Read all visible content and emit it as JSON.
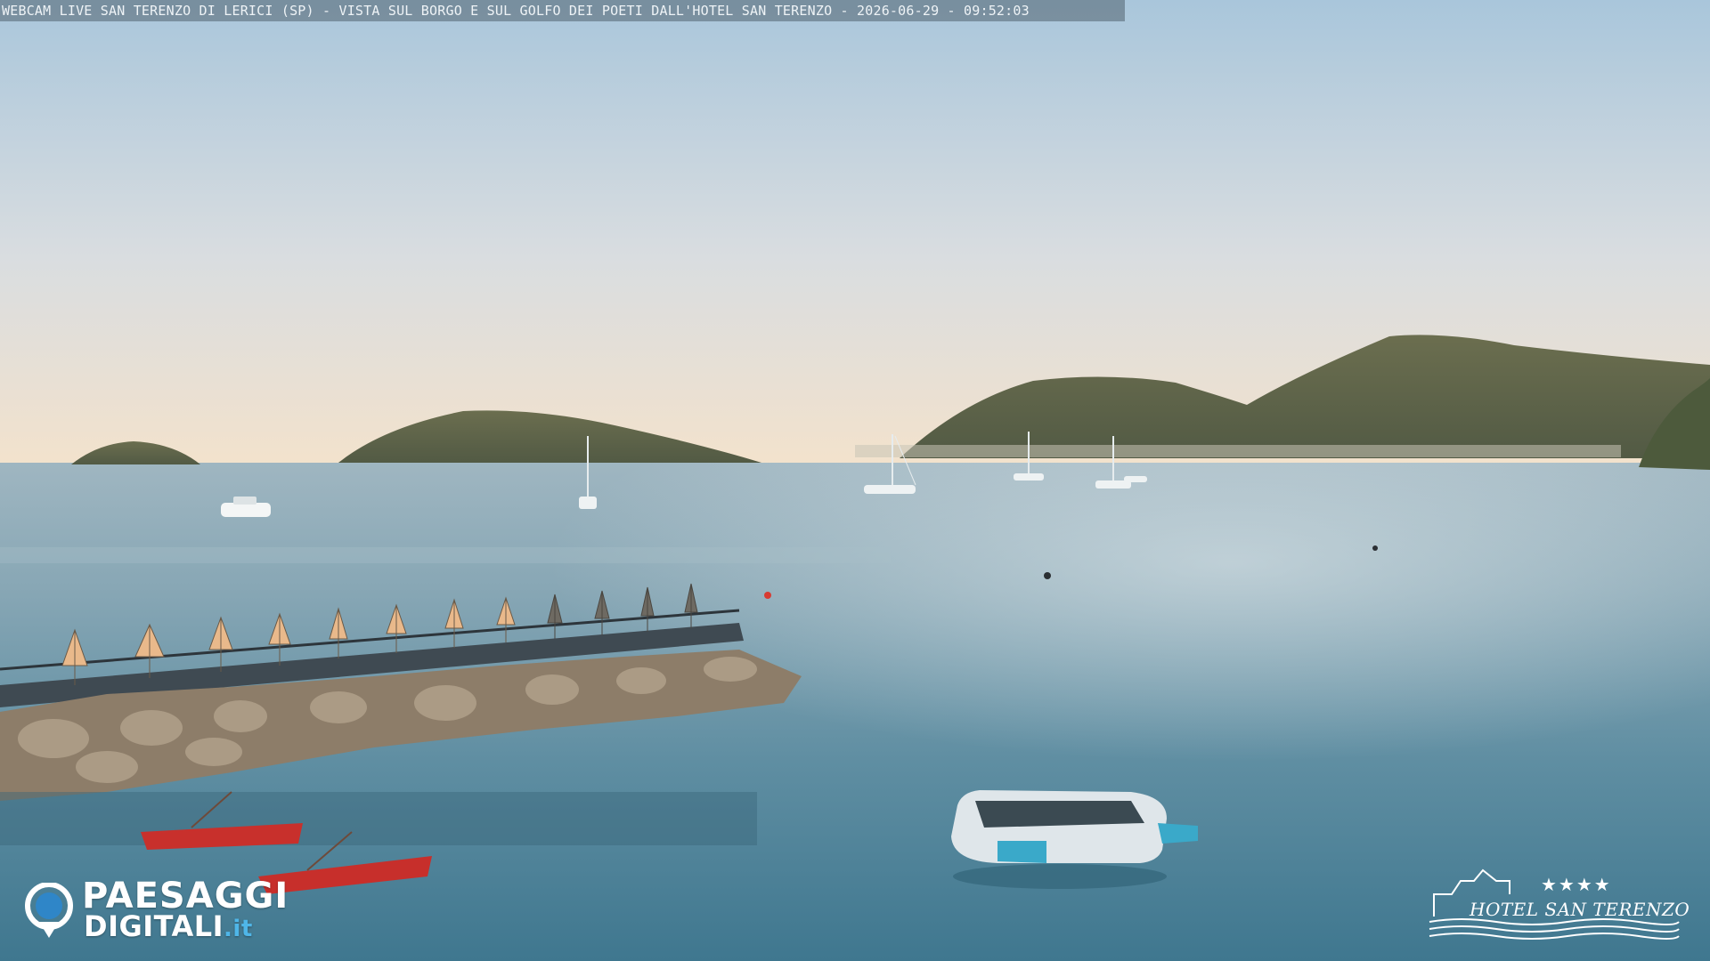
{
  "caption": {
    "text": "WEBCAM LIVE SAN TERENZO DI LERICI (SP) - VISTA SUL BORGO E SUL GOLFO DEI POETI DALL'HOTEL SAN TERENZO - 2026-06-29 - 09:52:03"
  },
  "logo_left": {
    "line1": "PAESAGGI",
    "line2": "DIGITALI",
    "suffix": ".it",
    "icon": "location-pin-icon",
    "accent_color": "#2f86c8"
  },
  "logo_right": {
    "stars": "★★★★",
    "name": "HOTEL SAN TERENZO"
  },
  "colors": {
    "sky_top": "#aac7dc",
    "sky_horizon": "#f2e3cf",
    "sea_far": "#8aa8b8",
    "sea_near": "#4b7f95",
    "hills": "#4f5a3f",
    "rocks": "#8a7b68",
    "umbrella": "#e7b98a",
    "rescue_boat": "#c9302c",
    "trampoline_accent": "#3aa9c9"
  }
}
